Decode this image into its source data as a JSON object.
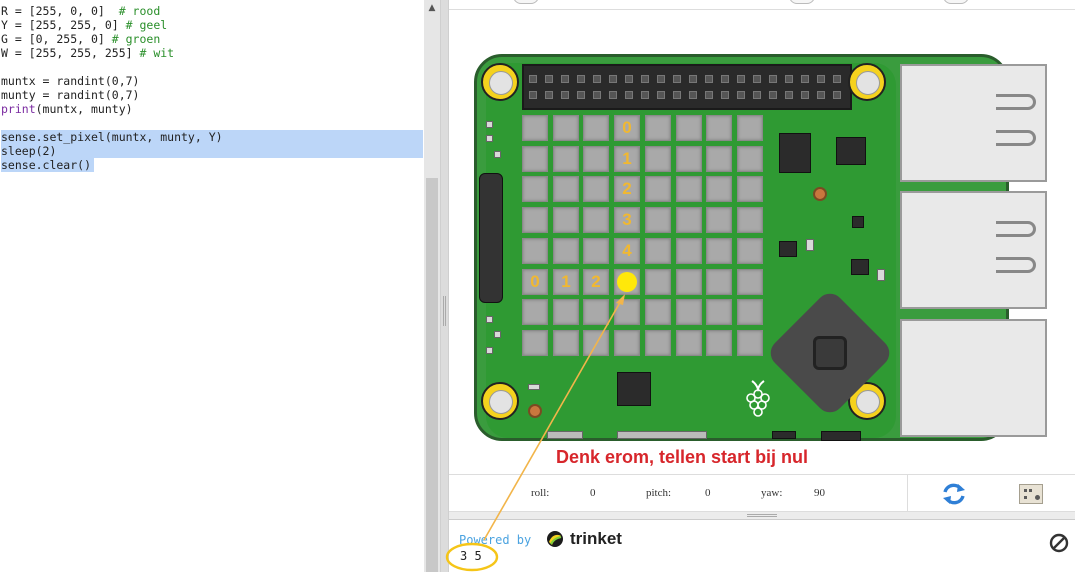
{
  "editor": {
    "lines": [
      {
        "code": "R = [255, 0, 0]  ",
        "comment": "# rood",
        "selected": false
      },
      {
        "code": "Y = [255, 255, 0] ",
        "comment": "# geel",
        "selected": false
      },
      {
        "code": "G = [0, 255, 0] ",
        "comment": "# groen",
        "selected": false
      },
      {
        "code": "W = [255, 255, 255] ",
        "comment": "# wit",
        "selected": false
      },
      {
        "code": "",
        "comment": "",
        "selected": false
      },
      {
        "code": "muntx = randint(0,7)",
        "comment": "",
        "selected": false
      },
      {
        "code": "munty = randint(0,7)",
        "comment": "",
        "selected": false
      },
      {
        "builtin": "print",
        "code": "(muntx, munty)",
        "comment": "",
        "selected": false
      },
      {
        "code": "",
        "comment": "",
        "selected": false
      },
      {
        "code": "sense.set_pixel(muntx, munty, Y)",
        "comment": "",
        "selected": true
      },
      {
        "code": "sleep(2)",
        "comment": "",
        "selected": true
      },
      {
        "code": "sense.clear()",
        "comment": "",
        "selected": true
      }
    ]
  },
  "emulator": {
    "led_matrix": {
      "rows": 8,
      "cols": 8,
      "lit_pixel": {
        "x": 3,
        "y": 5,
        "color": "#ffe80a"
      },
      "row_labels": [
        "0",
        "1",
        "2",
        "3",
        "4"
      ],
      "col_labels": [
        "0",
        "1",
        "2"
      ]
    },
    "annotation": "Denk erom, tellen start bij nul",
    "sensors": {
      "roll_label": "roll:",
      "roll_value": "0",
      "pitch_label": "pitch:",
      "pitch_value": "0",
      "yaw_label": "yaw:",
      "yaw_value": "90"
    }
  },
  "console": {
    "powered_by": "Powered by",
    "brand": "trinket",
    "output": "3 5"
  },
  "colors": {
    "board_green": "#3a9c3e",
    "annotation_red": "#d7262b",
    "label_orange": "#f1b830",
    "arrow_orange": "#f2b54a",
    "selection_blue": "#bcd6f8",
    "refresh_blue": "#2f7fd6"
  },
  "icons": {
    "refresh": "refresh-icon",
    "sense_hat": "sense-hat-icon",
    "stop": "stop-icon",
    "trinket_logo": "trinket-logo-icon",
    "raspberry": "raspberry-pi-logo-icon"
  }
}
